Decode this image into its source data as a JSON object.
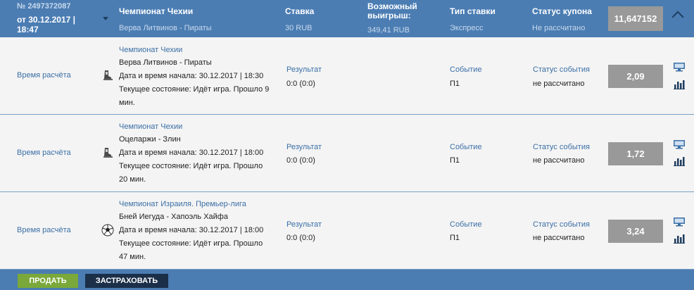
{
  "header": {
    "coupon_no": "№ 2497372087",
    "coupon_date": "от 30.12.2017 | 18:47",
    "event_title": "Чемпионат Чехии",
    "event_sub": "Верва Литвинов - Пираты",
    "stake_title": "Ставка",
    "stake_value": "30 RUB",
    "win_title": "Возможный выигрыш:",
    "win_value": "349,41 RUB",
    "type_title": "Тип ставки",
    "type_value": "Экспресс",
    "status_title": "Статус купона",
    "status_value": "Не рассчитано",
    "total_odds": "11,647152"
  },
  "rows": [
    {
      "calc": "Время расчёта",
      "sport_icon": "hockey-skate-icon",
      "championship": "Чемпионат Чехии",
      "teams": "Верва Литвинов - Пираты",
      "start": "Дата и время начала: 30.12.2017 | 18:30",
      "state": "Текущее состояние: Идёт игра. Прошло 9 мин.",
      "result_label": "Результат",
      "result_value": "0:0 (0:0)",
      "event_label": "Событие",
      "event_value": "П1",
      "status_label": "Статус события",
      "status_value": "не рассчитано",
      "odds": "2,09"
    },
    {
      "calc": "Время расчёта",
      "sport_icon": "hockey-skate-icon",
      "championship": "Чемпионат Чехии",
      "teams": "Оцеларжи - Злин",
      "start": "Дата и время начала: 30.12.2017 | 18:00",
      "state": "Текущее состояние: Идёт игра. Прошло 20 мин.",
      "result_label": "Результат",
      "result_value": "0:0 (0:0)",
      "event_label": "Событие",
      "event_value": "П1",
      "status_label": "Статус события",
      "status_value": "не рассчитано",
      "odds": "1,72"
    },
    {
      "calc": "Время расчёта",
      "sport_icon": "soccer-ball-icon",
      "championship": "Чемпионат Израиля. Премьер-лига",
      "teams": "Бней Иегуда - Хапоэль Хайфа",
      "start": "Дата и время начала: 30.12.2017 | 18:00",
      "state": "Текущее состояние: Идёт игра. Прошло 47 мин.",
      "result_label": "Результат",
      "result_value": "0:0 (0:0)",
      "event_label": "Событие",
      "event_value": "П1",
      "status_label": "Статус события",
      "status_value": "не рассчитано",
      "odds": "3,24"
    }
  ],
  "footer": {
    "sell_label": "ПРОДАТЬ",
    "insure_label": "ЗАСТРАХОВАТЬ"
  },
  "colors": {
    "header_bg": "#4b7db3",
    "link_blue": "#3b6fa6",
    "sell_green": "#7aa83a",
    "insure_navy": "#1b2f49",
    "odds_gray": "#999999"
  }
}
